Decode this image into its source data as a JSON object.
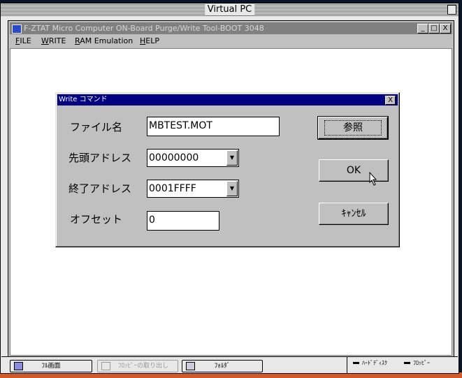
{
  "host": {
    "title": "Virtual PC"
  },
  "app": {
    "title": "F-ZTAT Micro Computer ON-Board Purge/Write Tool-BOOT 3048",
    "menu": [
      {
        "label": "FILE",
        "mnemonic": "F",
        "rest": "ILE"
      },
      {
        "label": "WRITE",
        "mnemonic": "W",
        "rest": "RITE"
      },
      {
        "label": "RAM Emulation",
        "mnemonic": "R",
        "rest": "AM Emulation"
      },
      {
        "label": "HELP",
        "mnemonic": "H",
        "rest": "ELP"
      }
    ],
    "controls": {
      "minimize": "_",
      "maximize": "□",
      "close": "X"
    }
  },
  "dialog": {
    "title": "Write コマンド",
    "close": "X",
    "file_label": "ファイル名",
    "file_value": "MBTEST.MOT",
    "start_label": "先頭アドレス",
    "start_value": "00000000",
    "end_label": "終了アドレス",
    "end_value": "0001FFFF",
    "offset_label": "オフセット",
    "offset_value": "0",
    "browse": "参照",
    "ok": "OK",
    "cancel": "ｷｬﾝｾﾙ",
    "dropdown_glyph": "▼"
  },
  "taskbar": {
    "fullscreen": "ﾌﾙ画面",
    "eject_floppy": "ﾌﾛｯﾋﾟｰの取り出し",
    "folder": "ﾌｫﾙﾀﾞ",
    "hdd_status": "ﾊｰﾄﾞﾃﾞｨｽｸ",
    "floppy_status": "ﾌﾛｯﾋﾟｰ"
  }
}
